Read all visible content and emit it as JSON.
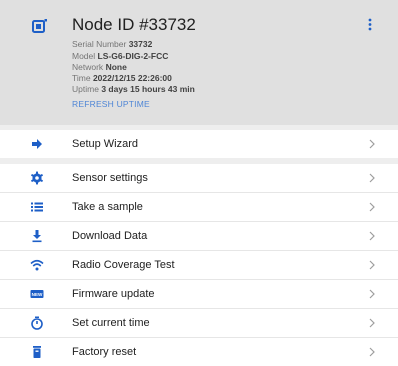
{
  "colors": {
    "accent": "#1e5fc7",
    "header_bg": "#e0e0e0",
    "link": "#4f86d6"
  },
  "node": {
    "icon": "node-device-icon",
    "title": "Node ID #33732",
    "serial_label": "Serial Number",
    "serial_value": "33732",
    "model_label": "Model",
    "model_value": "LS-G6-DIG-2-FCC",
    "network_label": "Network",
    "network_value": "None",
    "time_label": "Time",
    "time_value": "2022/12/15 22:26:00",
    "uptime_label": "Uptime",
    "uptime_value": "3 days 15 hours 43 min",
    "refresh_label": "REFRESH UPTIME"
  },
  "menu": [
    {
      "label": "Setup Wizard",
      "icon": "arrow-right-icon"
    },
    {
      "label": "Sensor settings",
      "icon": "gear-icon"
    },
    {
      "label": "Take a sample",
      "icon": "list-icon"
    },
    {
      "label": "Download Data",
      "icon": "download-icon"
    },
    {
      "label": "Radio Coverage Test",
      "icon": "wifi-icon"
    },
    {
      "label": "Firmware update",
      "icon": "new-badge-icon",
      "badge_text": "NEW"
    },
    {
      "label": "Set current time",
      "icon": "timer-icon"
    },
    {
      "label": "Factory reset",
      "icon": "delete-icon"
    }
  ]
}
